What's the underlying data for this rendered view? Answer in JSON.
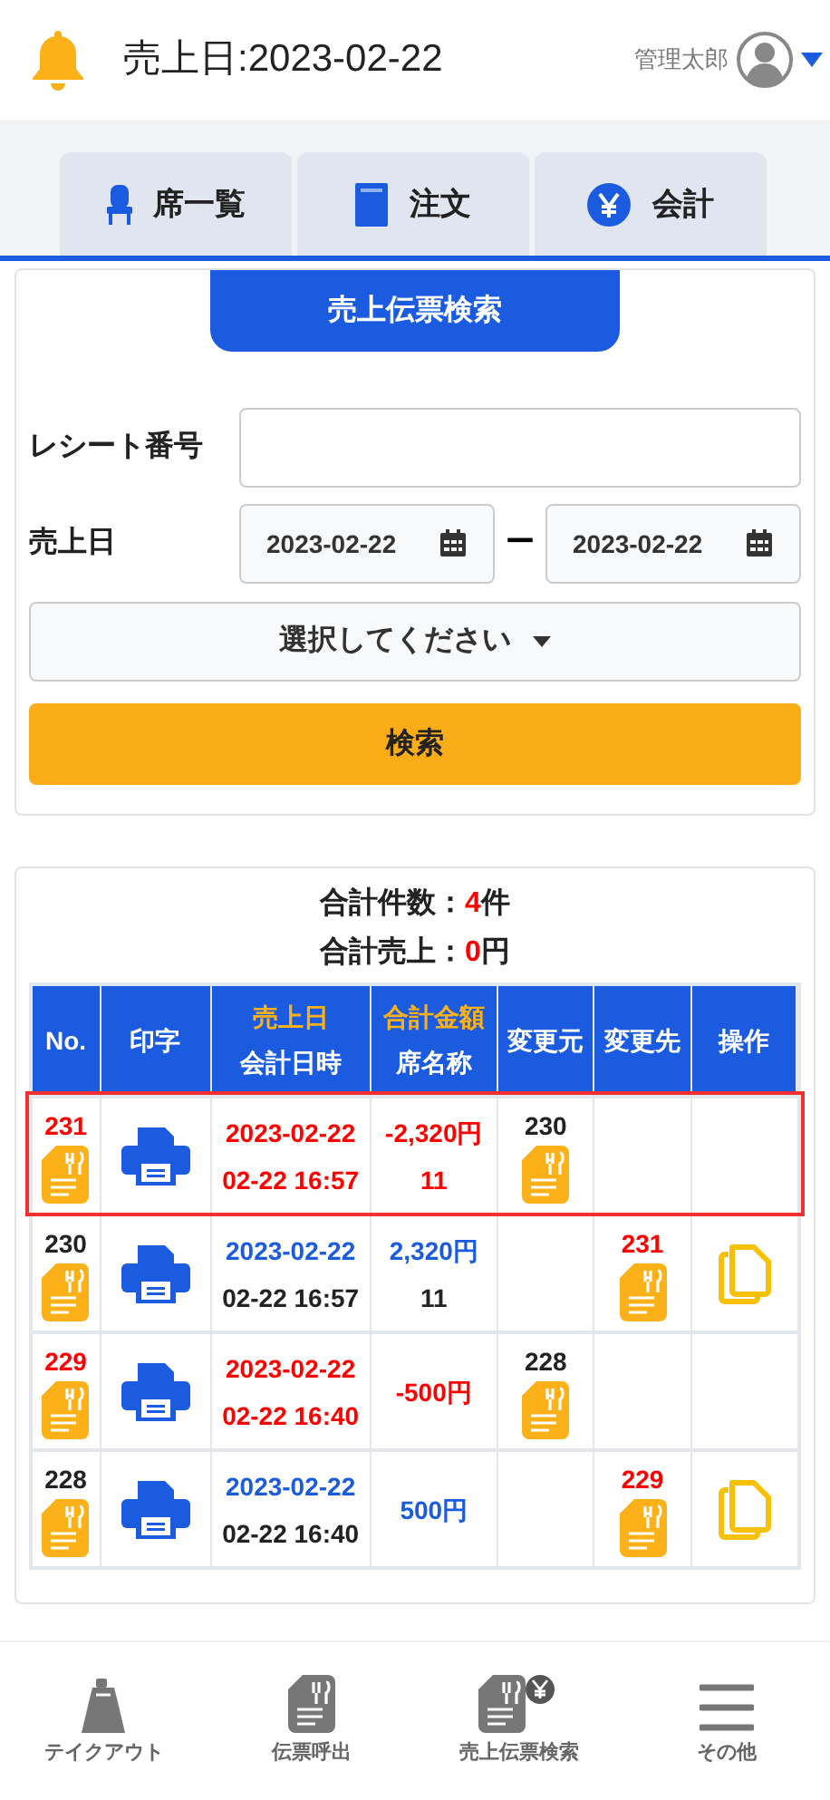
{
  "header": {
    "title": "売上日:2023-02-22",
    "user": "管理太郎"
  },
  "tabs": [
    {
      "label": "席一覧"
    },
    {
      "label": "注文"
    },
    {
      "label": "会計"
    }
  ],
  "search": {
    "title": "売上伝票検索",
    "receipt_label": "レシート番号",
    "date_label": "売上日",
    "date_from": "2023-02-22",
    "separator": "ー",
    "date_to": "2023-02-22",
    "select": "選択してください",
    "button": "検索"
  },
  "summary": [
    {
      "label": "合計件数：",
      "value": "4",
      "unit": "件"
    },
    {
      "label": "合計売上：",
      "value": "0",
      "unit": "円"
    }
  ],
  "columns": [
    {
      "label": "No."
    },
    {
      "label": "印字"
    },
    {
      "label": "売上日",
      "sublabel": "会計日時"
    },
    {
      "label": "合計金額",
      "sublabel": "席名称"
    },
    {
      "label": "変更元"
    },
    {
      "label": "変更先"
    },
    {
      "label": "操作"
    }
  ],
  "rows": [
    {
      "kind": "refund",
      "selected": true,
      "no": "231",
      "date": "2023-02-22",
      "time": "02-22 16:57",
      "amount": "-2,320円",
      "seat": "11",
      "from_no": "230",
      "copyable": false
    },
    {
      "kind": "normal",
      "selected": false,
      "no": "230",
      "date": "2023-02-22",
      "time": "02-22 16:57",
      "amount": "2,320円",
      "seat": "11",
      "to_no": "231",
      "copyable": true
    },
    {
      "kind": "refund",
      "selected": false,
      "no": "229",
      "date": "2023-02-22",
      "time": "02-22 16:40",
      "amount": "-500円",
      "from_no": "228",
      "copyable": false
    },
    {
      "kind": "normal",
      "selected": false,
      "no": "228",
      "date": "2023-02-22",
      "time": "02-22 16:40",
      "amount": "500円",
      "to_no": "229",
      "copyable": true
    }
  ],
  "bottom_nav": [
    {
      "label": "テイクアウト"
    },
    {
      "label": "伝票呼出"
    },
    {
      "label": "売上伝票検索"
    },
    {
      "label": "その他"
    }
  ]
}
